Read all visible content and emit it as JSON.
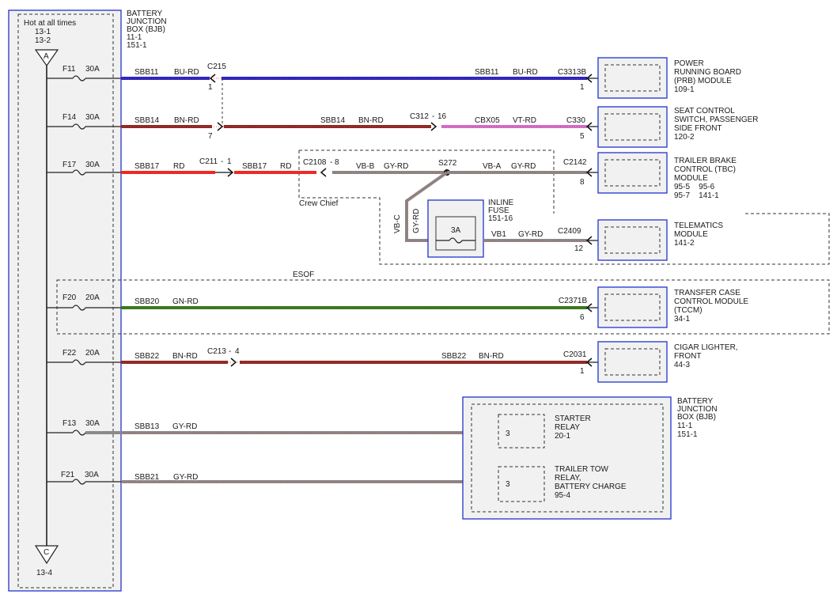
{
  "bjb_left": {
    "title": [
      "BATTERY",
      "JUNCTION",
      "BOX (BJB)",
      "11-1",
      "151-1"
    ],
    "hot_at_all_times": "Hot at all times",
    "refs_top": [
      "13-1",
      "13-2"
    ],
    "connector_a": "A",
    "connector_c": "C",
    "ref_bottom": "13-4"
  },
  "fuses": [
    {
      "id": "F11",
      "rating": "30A"
    },
    {
      "id": "F14",
      "rating": "30A"
    },
    {
      "id": "F17",
      "rating": "30A"
    },
    {
      "id": "F20",
      "rating": "20A"
    },
    {
      "id": "F22",
      "rating": "20A"
    },
    {
      "id": "F13",
      "rating": "30A"
    },
    {
      "id": "F21",
      "rating": "30A"
    }
  ],
  "circuits": {
    "sbb11": {
      "name": "SBB11",
      "color": "BU-RD",
      "connector": "C215",
      "pin": "1",
      "name2": "SBB11",
      "color2": "BU-RD",
      "end_connector": "C3313B",
      "end_pin": "1"
    },
    "sbb14": {
      "name": "SBB14",
      "color": "BN-RD",
      "pin": "7",
      "name2": "SBB14",
      "color2": "BN-RD",
      "connector": "C312",
      "connector_pin": "16",
      "name3": "CBX05",
      "color3": "VT-RD",
      "end_connector": "C330",
      "end_pin": "5"
    },
    "sbb17": {
      "name": "SBB17",
      "color": "RD",
      "connector": "C211",
      "connector_pin": "1",
      "name2": "SBB17",
      "color2": "RD",
      "connector2": "C2108",
      "connector2_pin": "8",
      "name3": "VB-B",
      "color3": "GY-RD",
      "splice": "S272",
      "name4": "VB-A",
      "color4": "GY-RD",
      "end_connector": "C2142",
      "end_pin": "8",
      "crew_chief": "Crew Chief"
    },
    "vbc": {
      "name": "VB-C",
      "color": "GY-RD",
      "fuse_title": [
        "INLINE",
        "FUSE",
        "151-16"
      ],
      "fuse_rating": "3A",
      "name2": "VB1",
      "color2": "GY-RD",
      "end_connector": "C2409",
      "end_pin": "12"
    },
    "esof_label": "ESOF",
    "sbb20": {
      "name": "SBB20",
      "color": "GN-RD",
      "end_connector": "C2371B",
      "end_pin": "6"
    },
    "sbb22": {
      "name": "SBB22",
      "color": "BN-RD",
      "connector": "C213",
      "connector_pin": "4",
      "name2": "SBB22",
      "color2": "BN-RD",
      "end_connector": "C2031",
      "end_pin": "1"
    },
    "sbb13": {
      "name": "SBB13",
      "color": "GY-RD"
    },
    "sbb21": {
      "name": "SBB21",
      "color": "GY-RD"
    }
  },
  "modules": [
    {
      "lines": [
        "POWER",
        "RUNNING BOARD",
        "(PRB) MODULE",
        "109-1"
      ]
    },
    {
      "lines": [
        "SEAT CONTROL",
        "SWITCH, PASSENGER",
        "SIDE FRONT",
        "120-2"
      ]
    },
    {
      "lines": [
        "TRAILER BRAKE",
        "CONTROL (TBC)",
        "MODULE",
        "95-5    95-6",
        "95-7    141-1"
      ]
    },
    {
      "lines": [
        "TELEMATICS",
        "MODULE",
        "141-2"
      ]
    },
    {
      "lines": [
        "TRANSFER CASE",
        "CONTROL MODULE",
        "(TCCM)",
        "34-1"
      ]
    },
    {
      "lines": [
        "CIGAR LIGHTER,",
        "FRONT",
        "44-3"
      ]
    }
  ],
  "bjb_right": {
    "title": [
      "BATTERY",
      "JUNCTION",
      "BOX (BJB)",
      "11-1",
      "151-1"
    ],
    "starter_relay": {
      "pin": "3",
      "lines": [
        "STARTER",
        "RELAY",
        "20-1"
      ]
    },
    "trailer_relay": {
      "pin": "3",
      "lines": [
        "TRAILER TOW",
        "RELAY,",
        "BATTERY CHARGE",
        "95-4"
      ]
    }
  },
  "colors": {
    "blue": "#2424c8",
    "brown": "#8b2a26",
    "red": "#ee2a24",
    "gray": "#8a8a8a",
    "green": "#2f7d1e",
    "violet": "#d070d0",
    "box_blue": "#2233cc"
  }
}
